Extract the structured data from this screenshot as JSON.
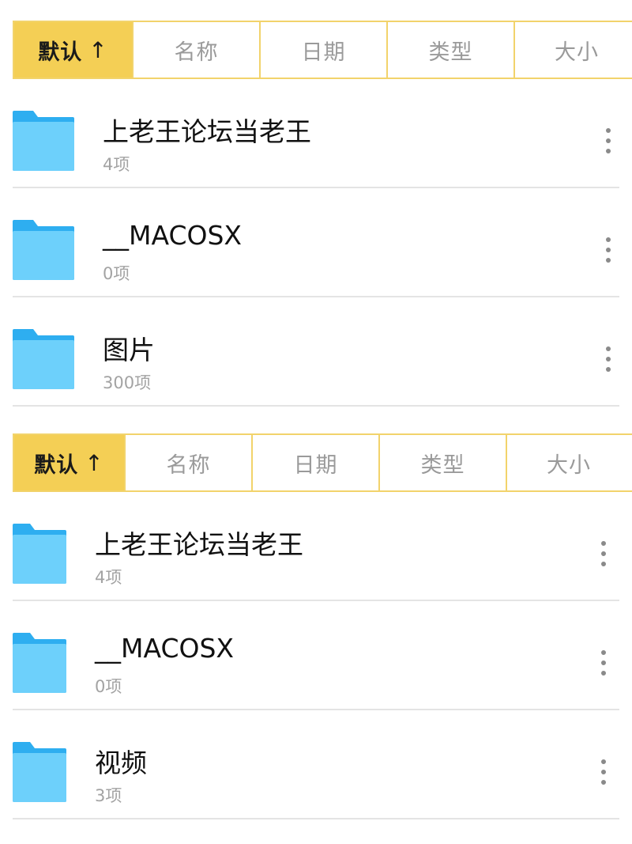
{
  "colors": {
    "accent": "#f4cf55",
    "tab_border": "#f2d36b",
    "folder_body": "#6dd0fb",
    "folder_tab": "#2eaef0",
    "divider": "#e4e4e4",
    "muted_text": "#a3a3a3"
  },
  "panels": [
    {
      "sort_tabs": [
        {
          "label": "默认",
          "arrow": "↑",
          "active": true
        },
        {
          "label": "名称",
          "active": false
        },
        {
          "label": "日期",
          "active": false
        },
        {
          "label": "类型",
          "active": false
        },
        {
          "label": "大小",
          "active": false
        }
      ],
      "items": [
        {
          "name": "上老王论坛当老王",
          "count": "4项",
          "icon": "folder-icon"
        },
        {
          "name": "__MACOSX",
          "count": "0项",
          "icon": "folder-icon"
        },
        {
          "name": "图片",
          "count": "300项",
          "icon": "folder-icon"
        }
      ]
    },
    {
      "sort_tabs": [
        {
          "label": "默认",
          "arrow": "↑",
          "active": true
        },
        {
          "label": "名称",
          "active": false
        },
        {
          "label": "日期",
          "active": false
        },
        {
          "label": "类型",
          "active": false
        },
        {
          "label": "大小",
          "active": false
        }
      ],
      "items": [
        {
          "name": "上老王论坛当老王",
          "count": "4项",
          "icon": "folder-icon"
        },
        {
          "name": "__MACOSX",
          "count": "0项",
          "icon": "folder-icon"
        },
        {
          "name": "视频",
          "count": "3项",
          "icon": "folder-icon"
        }
      ]
    }
  ]
}
